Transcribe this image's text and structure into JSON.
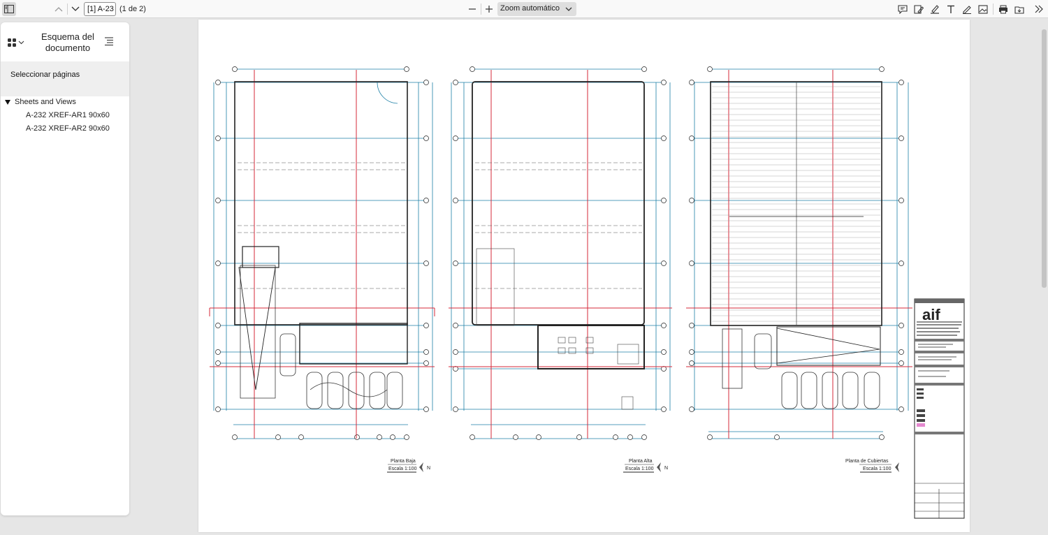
{
  "toolbar": {
    "page_input_value": "[1] A-23",
    "page_count": "(1 de 2)",
    "zoom_value": "Zoom automático",
    "icons": [
      "sidebar-toggle-icon",
      "chevron-up-icon",
      "chevron-down-icon",
      "minus-icon",
      "plus-icon",
      "comment-icon",
      "signature-icon",
      "highlight-icon",
      "text-icon",
      "draw-icon",
      "image-icon",
      "print-icon",
      "save-icon",
      "more-tools-icon"
    ]
  },
  "sidebar": {
    "title": "Esquema del documento",
    "select_pages": "Seleccionar páginas",
    "tree_root": "Sheets and Views",
    "tree_items": [
      "A-232 XREF-AR1 90x60",
      "A-232 XREF-AR2 90x60"
    ]
  },
  "drawing": {
    "plans": [
      {
        "name": "Planta Baja",
        "scale": "Escala 1:100"
      },
      {
        "name": "Planta Alta",
        "scale": "Escala 1:100"
      },
      {
        "name": "Planta de Cubiertas",
        "scale": "Escala 1:100"
      }
    ],
    "north_label": "N",
    "logo": "aif",
    "colors": {
      "grid_blue": "#1d7fa6",
      "axis_red": "#d6283a",
      "line_black": "#222222"
    }
  }
}
